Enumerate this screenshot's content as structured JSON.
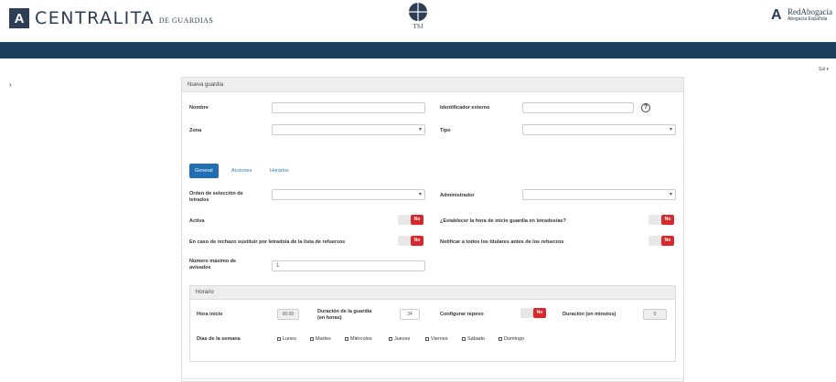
{
  "header": {
    "logo_mark": "A",
    "app_title": "CENTRALITA",
    "app_subtitle": "DE GUARDIAS",
    "center_logo_text": "TSJ",
    "right_logo_mark": "A",
    "right_logo_title": "RedAbogacía",
    "right_logo_subtitle": "Abogacía Española"
  },
  "colors": {
    "navbar": "#1b3e5c",
    "primary": "#1f6fb2",
    "toggle_off": "#d9282b"
  },
  "topbar": {
    "user_link": "Sal ▾",
    "side_mark": "›"
  },
  "panel": {
    "title": "Nueva guardia",
    "fields": {
      "nombre_label": "Nombre",
      "identificador_label": "Identificador externo",
      "zona_label": "Zona",
      "tipo_label": "Tipo",
      "help_icon": "?"
    },
    "tabs": [
      "General",
      "Acciones",
      "Horarios"
    ],
    "general": {
      "orden_label": "Orden de selección de letrados",
      "administrador_label": "Administrador",
      "activo_label": "Activa",
      "establecer_label": "¿Establecer la hora de inicio guardia en letrados/as?",
      "sustituir_label": "En caso de rechazo sustituir por letrado/a de la lista de refuerzos",
      "notificar_label": "Notificar a todos los titulares antes de los refuerzos",
      "numero_label": "Número máximo de avisados",
      "numero_value": "1",
      "toggle_no": "No"
    },
    "horario": {
      "title": "Horario",
      "hora_inicio_label": "Hora inicio",
      "hora_inicio_value": "00:00",
      "duracion_label": "Duración de la guardia (en horas)",
      "duracion_value": "24",
      "configurar_label": "Configurar repeso",
      "duracion_min_label": "Duración (en minutos)",
      "duracion_min_value": "0",
      "dias_label": "Días de la semana",
      "days": [
        "Lunes",
        "Martes",
        "Miércoles",
        "Jueves",
        "Viernes",
        "Sábado",
        "Domingo"
      ]
    }
  }
}
